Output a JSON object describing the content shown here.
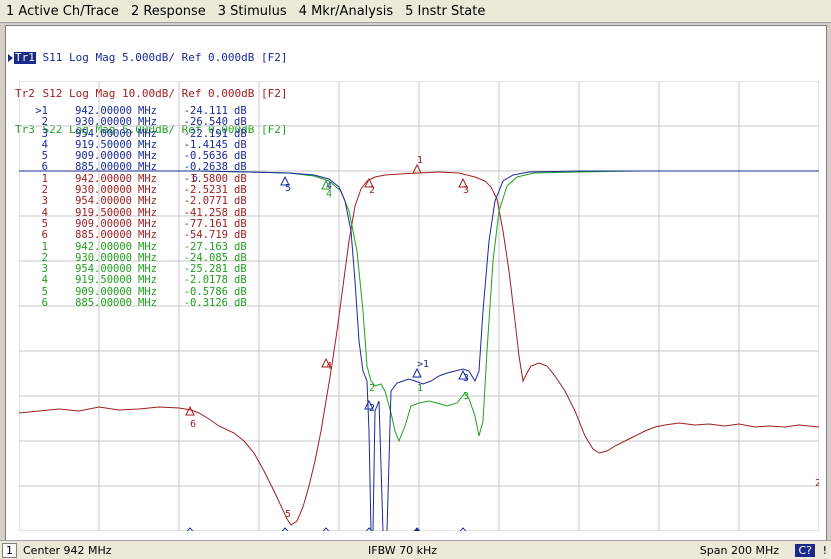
{
  "menu": [
    "1 Active Ch/Trace",
    "2 Response",
    "3 Stimulus",
    "4 Mkr/Analysis",
    "5 Instr State"
  ],
  "colors": {
    "tr1": "#1a2a9a",
    "tr2": "#a02020",
    "tr3": "#20a020",
    "grid": "#c0c0c0",
    "active_bg": "#1a2a8a"
  },
  "traces": [
    {
      "tag": "Tr1",
      "text": " S11 Log Mag 5.000dB/ Ref 0.000dB [F2]",
      "active": true,
      "color": "#1a2a9a"
    },
    {
      "tag": "Tr2",
      "text": " S12 Log Mag 10.00dB/ Ref 0.000dB [F2]",
      "active": false,
      "color": "#a02020"
    },
    {
      "tag": "Tr3",
      "text": " S22 Log Mag 5.000dB/ Ref 0.000dB [F2]",
      "active": false,
      "color": "#20a020"
    }
  ],
  "markers": [
    {
      "num": ">1",
      "freq": "942.00000",
      "unit": "MHz",
      "val": "-24.111",
      "db": "dB",
      "trace": "tr1"
    },
    {
      "num": "2",
      "freq": "930.00000",
      "unit": "MHz",
      "val": "-26.540",
      "db": "dB",
      "trace": "tr1"
    },
    {
      "num": "3",
      "freq": "954.00000",
      "unit": "MHz",
      "val": "-22.191",
      "db": "dB",
      "trace": "tr1"
    },
    {
      "num": "4",
      "freq": "919.50000",
      "unit": "MHz",
      "val": "-1.4145",
      "db": "dB",
      "trace": "tr1"
    },
    {
      "num": "5",
      "freq": "909.00000",
      "unit": "MHz",
      "val": "-0.5636",
      "db": "dB",
      "trace": "tr1"
    },
    {
      "num": "6",
      "freq": "885.00000",
      "unit": "MHz",
      "val": "-0.2638",
      "db": "dB",
      "trace": "tr1"
    },
    {
      "num": "1",
      "freq": "942.00000",
      "unit": "MHz",
      "val": "-1.5800",
      "db": "dB",
      "trace": "tr2"
    },
    {
      "num": "2",
      "freq": "930.00000",
      "unit": "MHz",
      "val": "-2.5231",
      "db": "dB",
      "trace": "tr2"
    },
    {
      "num": "3",
      "freq": "954.00000",
      "unit": "MHz",
      "val": "-2.0771",
      "db": "dB",
      "trace": "tr2"
    },
    {
      "num": "4",
      "freq": "919.50000",
      "unit": "MHz",
      "val": "-41.258",
      "db": "dB",
      "trace": "tr2"
    },
    {
      "num": "5",
      "freq": "909.00000",
      "unit": "MHz",
      "val": "-77.161",
      "db": "dB",
      "trace": "tr2"
    },
    {
      "num": "6",
      "freq": "885.00000",
      "unit": "MHz",
      "val": "-54.719",
      "db": "dB",
      "trace": "tr2"
    },
    {
      "num": "1",
      "freq": "942.00000",
      "unit": "MHz",
      "val": "-27.163",
      "db": "dB",
      "trace": "tr3"
    },
    {
      "num": "2",
      "freq": "930.00000",
      "unit": "MHz",
      "val": "-24.085",
      "db": "dB",
      "trace": "tr3"
    },
    {
      "num": "3",
      "freq": "954.00000",
      "unit": "MHz",
      "val": "-25.281",
      "db": "dB",
      "trace": "tr3"
    },
    {
      "num": "4",
      "freq": "919.50000",
      "unit": "MHz",
      "val": "-2.0178",
      "db": "dB",
      "trace": "tr3"
    },
    {
      "num": "5",
      "freq": "909.00000",
      "unit": "MHz",
      "val": "-0.5786",
      "db": "dB",
      "trace": "tr3"
    },
    {
      "num": "6",
      "freq": "885.00000",
      "unit": "MHz",
      "val": "-0.3126",
      "db": "dB",
      "trace": "tr3"
    }
  ],
  "status": {
    "channel": "1",
    "center": "Center 942 MHz",
    "ifbw": "IFBW 70 kHz",
    "span": "Span 200 MHz",
    "cal": "C?",
    "flag": "!"
  },
  "right_label": "2"
}
